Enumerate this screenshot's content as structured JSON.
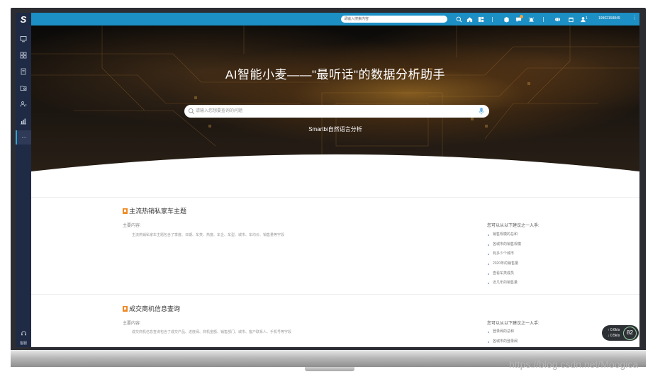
{
  "app": {
    "logo_text": "S"
  },
  "sidebar": {
    "items": [
      {
        "icon": "monitor-icon"
      },
      {
        "icon": "grid-icon"
      },
      {
        "icon": "document-icon"
      },
      {
        "icon": "folder-gear-icon"
      },
      {
        "icon": "user-flow-icon"
      },
      {
        "icon": "bar-chart-icon"
      },
      {
        "icon": "more-icon",
        "label": "···",
        "active": true
      }
    ],
    "help_label": "客服"
  },
  "topbar": {
    "search_placeholder": "请输入搜索内容",
    "icons": [
      "search-icon",
      "home-icon",
      "layout-icon",
      "package-icon",
      "message-icon",
      "alarm-icon",
      "globe-icon",
      "calendar-icon",
      "user-icon"
    ],
    "message_badge_color": "#f3a03a",
    "user_number": "1",
    "user_phone": "19902158849",
    "more_label": "⋮"
  },
  "hero": {
    "title": "AI智能小麦——\"最听话\"的数据分析助手",
    "search_placeholder": "请输入您想要查询的问题",
    "subtitle": "Smartbi自然语言分析"
  },
  "sections": [
    {
      "title": "主流热销私家车主题",
      "main_label": "主要内容:",
      "description": "主流热销私家车主题包含了季度、日期、车类、热度、车企、车型、城市、车均价、销售量等字段",
      "suggestions_title": "您可以从以下建议之一入手:",
      "suggestions": [
        "销售规模的总和",
        "各城市的销售规模",
        "有多少个城市",
        "2020年的销售量",
        "查看车类成员",
        "近几年的销售量"
      ]
    },
    {
      "title": "成交商机信息查询",
      "main_label": "主要内容:",
      "description": "成交商机信息查询包含了成交产品、进度阀、商机金额、销售部门、城市、客户联系人、手机号等字段",
      "suggestions_title": "您可以从以下建议之一入手:",
      "suggestions": [
        "登录阀的总和",
        "各城市的登录阀"
      ]
    }
  ],
  "speed_widget": {
    "upload": "↑ 0.6k/s",
    "download": "↓ 0.5k/s",
    "percent": "82",
    "ring_color": "#9bd6a8"
  },
  "watermark": "https://blog.csdn.net/Moogica",
  "colors": {
    "topbar": "#1c8fc4",
    "sidebar": "#1f2a44",
    "accent": "#f08a24"
  }
}
